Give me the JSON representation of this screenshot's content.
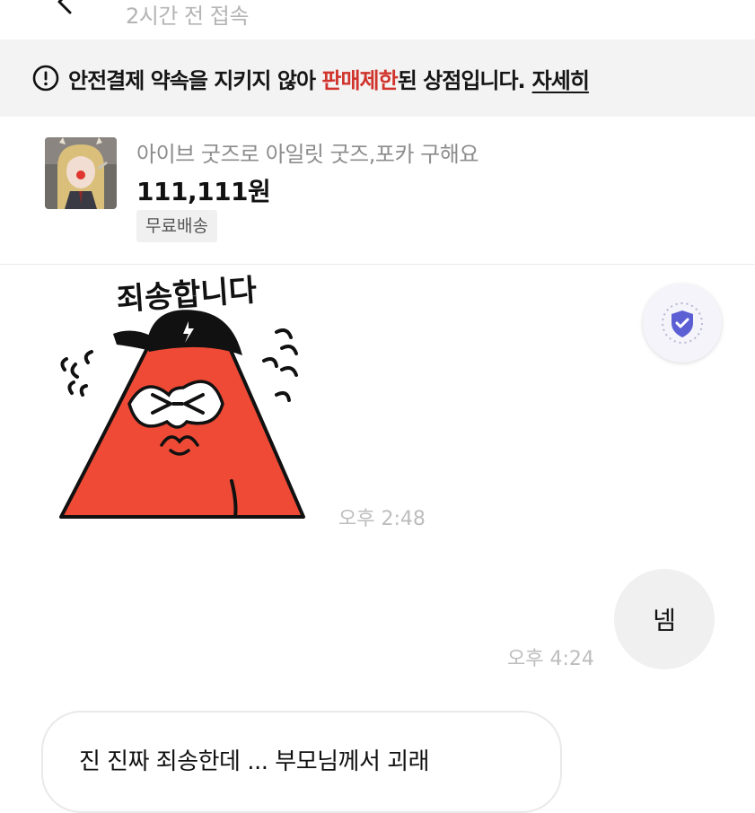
{
  "header": {
    "status": "2시간 전 접속"
  },
  "warning": {
    "prefix": "안전결제 약속을 지키지 않아 ",
    "highlight": "판매제한",
    "suffix": "된 상점입니다.",
    "link": "자세히",
    "highlight_color": "#d0342c"
  },
  "product": {
    "title": "아이브 굿즈로 아일릿 굿즈,포카 구해요",
    "price": "111,111원",
    "badge": "무료배송"
  },
  "messages": {
    "sticker_text": "죄송합니다",
    "sticker_time": "오후 2:48",
    "outgoing_text": "넴",
    "outgoing_time": "오후 4:24",
    "incoming_partial": "진 진짜 죄송한데 ... 부모님께서 괴래"
  },
  "icons": {
    "back": "chevron-left-icon",
    "warning": "exclamation-circle-icon",
    "safety": "shield-check-icon"
  }
}
